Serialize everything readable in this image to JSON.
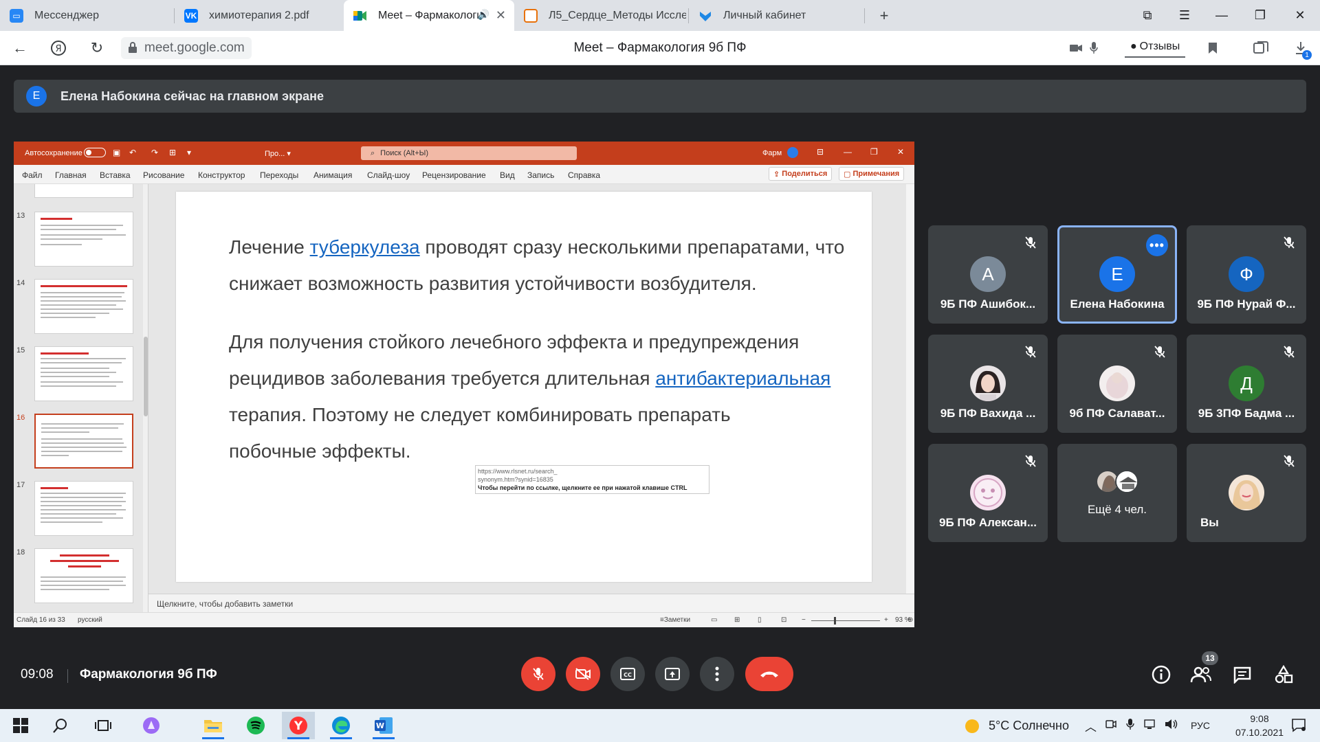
{
  "browser": {
    "tabs": [
      {
        "label": "Мессенджер",
        "icon": "messenger-icon",
        "color": "#2787f5"
      },
      {
        "label": "химиотерапия 2.pdf",
        "icon": "vk-icon",
        "color": "#0077ff"
      },
      {
        "label": "Meet – Фармакологи",
        "icon": "meet-icon",
        "color": "#00897b"
      },
      {
        "label": "Л5_Сердце_Методы Иссле",
        "icon": "pdf-icon",
        "color": "#e8710a"
      },
      {
        "label": "Личный кабинет",
        "icon": "shield-icon",
        "color": "#1e88e5"
      }
    ],
    "url": "meet.google.com",
    "page_title": "Meet – Фармакология 9б ПФ",
    "reviews_label": "Отзывы",
    "downloads_badge": "1"
  },
  "notification": {
    "avatar_letter": "Е",
    "text": "Елена Набокина сейчас на главном экране"
  },
  "powerpoint": {
    "autosave": "Автосохранение",
    "file_name": "Про...",
    "search_placeholder": "Поиск (Alt+Ы)",
    "user": "Фарм",
    "menu": [
      "Файл",
      "Главная",
      "Вставка",
      "Рисование",
      "Конструктор",
      "Переходы",
      "Анимация",
      "Слайд-шоу",
      "Рецензирование",
      "Вид",
      "Запись",
      "Справка"
    ],
    "share": "Поделиться",
    "comments": "Примечания",
    "thumbnail_numbers": [
      "13",
      "14",
      "15",
      "16",
      "17",
      "18"
    ],
    "selected_slide": "16",
    "slide": {
      "p1_a": "Лечение ",
      "p1_link": "туберкулеза",
      "p1_b": " проводят сразу несколькими препаратами, что снижает возможность развития устойчивости возбудителя.",
      "p2_a": "Для получения стойкого лечебного эффекта и предупреждения рецидивов заболевания требуется длительная ",
      "p2_link": "антибактериальная",
      "p2_b": " терапия. Поэтому не следует комбинировать препарать",
      "p2_c": "побочные эффекты."
    },
    "tooltip": {
      "url_line1": "https://www.rlsnet.ru/search_",
      "url_line2": "synonym.htm?synid=16835",
      "hint": "Чтобы перейти по ссылке, щелкните ее при нажатой клавише CTRL"
    },
    "notes_placeholder": "Щелкните, чтобы добавить заметки",
    "status": {
      "slide_of": "Слайд 16 из 33",
      "language": "русский",
      "notes": "Заметки",
      "zoom": "93 %"
    }
  },
  "participants": [
    {
      "name": "9Б ПФ Ашибок...",
      "letter": "А",
      "color": "#7b8a99",
      "muted": true
    },
    {
      "name": "Елена Набокина",
      "letter": "Е",
      "color": "#1a73e8",
      "muted": false,
      "speaking": true
    },
    {
      "name": "9Б ПФ Нурай Ф...",
      "letter": "Ф",
      "color": "#1565c0",
      "muted": true
    },
    {
      "name": "9Б ПФ Вахида ...",
      "letter": "",
      "muted": true
    },
    {
      "name": "9б ПФ Салават...",
      "letter": "",
      "muted": true
    },
    {
      "name": "9Б 3ПФ Бадма ...",
      "letter": "Д",
      "color": "#2e7d32",
      "muted": true
    },
    {
      "name": "9Б ПФ Алексан...",
      "letter": "",
      "muted": true
    },
    {
      "name": "Ещё 4 чел.",
      "letter": "",
      "muted": false
    },
    {
      "name": "Вы",
      "letter": "",
      "muted": true
    }
  ],
  "meet_bar": {
    "time": "09:08",
    "meeting_title": "Фармакология 9б ПФ",
    "participant_count": "13"
  },
  "taskbar": {
    "weather": "5°C  Солнечно",
    "language": "РУС",
    "time": "9:08",
    "date": "07.10.2021"
  }
}
